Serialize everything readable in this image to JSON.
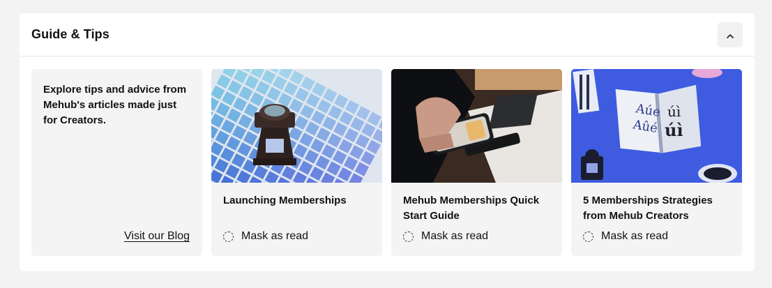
{
  "panel": {
    "title": "Guide & Tips",
    "collapse_icon": "chevron-up-icon"
  },
  "intro": {
    "text": "Explore tips and advice from Mehub's articles made just for Creators.",
    "link_label": "Visit our Blog"
  },
  "articles": [
    {
      "title": "Launching Memberships",
      "image": "color-swatch-with-loupe-image",
      "mark_label": "Mask as read"
    },
    {
      "title": "Mehub Memberships Quick Start Guide",
      "image": "hand-holding-phone-image",
      "mark_label": "Mask as read"
    },
    {
      "title": "5 Memberships Strategies from Mehub Creators",
      "image": "floating-books-on-blue-image",
      "mark_label": "Mask as read"
    }
  ],
  "colors": {
    "background": "#f3f3f3",
    "panel": "#ffffff",
    "card": "#f4f4f4",
    "collapse_button": "#f1f1f1",
    "accent_blue": "#3f5be0"
  }
}
